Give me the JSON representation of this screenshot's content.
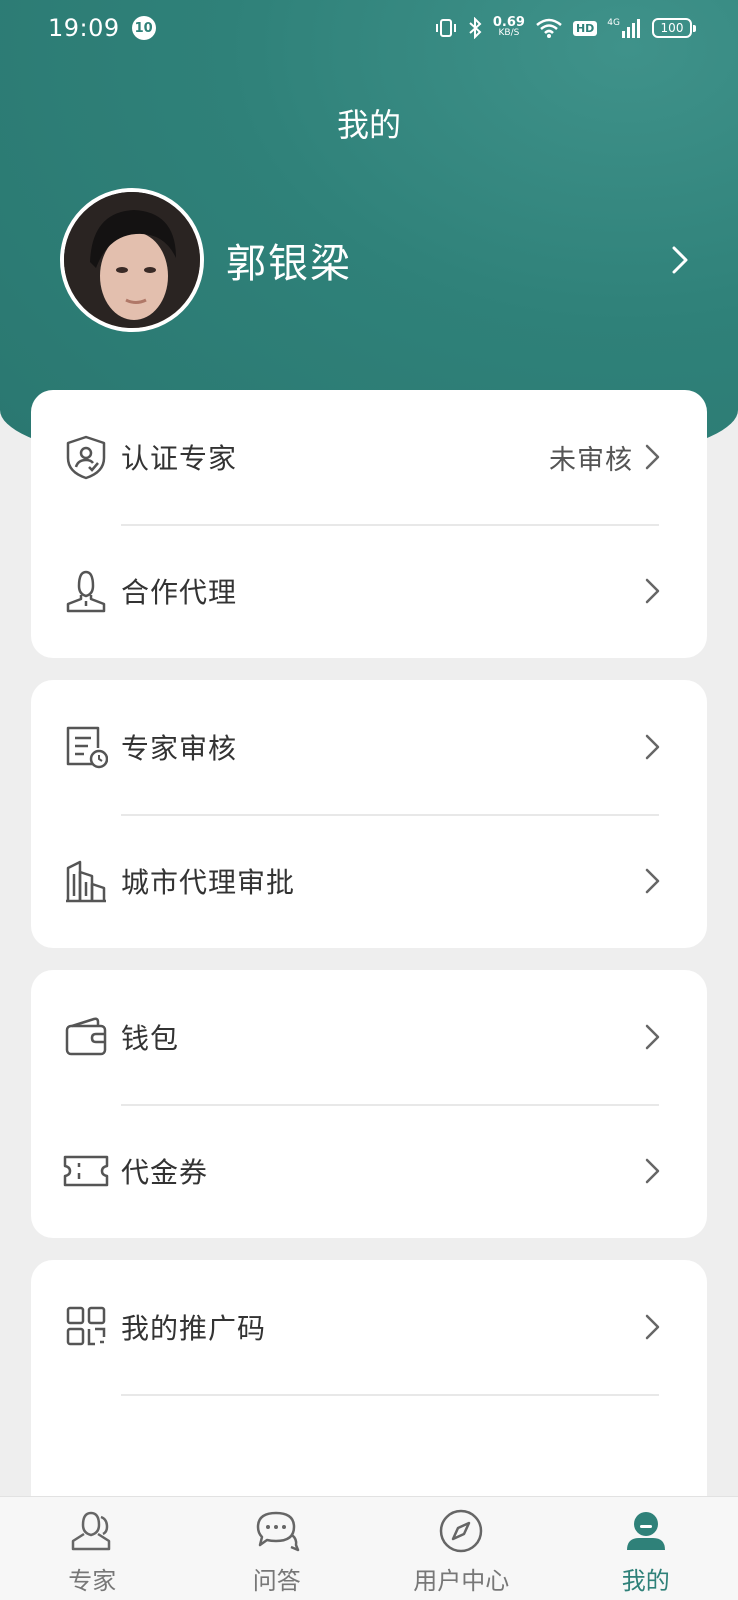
{
  "status_bar": {
    "time": "19:09",
    "notification_count": "10",
    "net_speed": "0.69",
    "net_unit": "KB/S",
    "hd": "HD",
    "network": "4G",
    "battery": "100"
  },
  "header": {
    "title": "我的"
  },
  "profile": {
    "name": "郭银梁"
  },
  "menu": {
    "cert_expert": {
      "label": "认证专家",
      "value": "未审核",
      "icon": "shield-user-icon"
    },
    "partner_agent": {
      "label": "合作代理",
      "icon": "person-icon"
    },
    "expert_review": {
      "label": "专家审核",
      "icon": "document-clock-icon"
    },
    "city_agent_approval": {
      "label": "城市代理审批",
      "icon": "buildings-icon"
    },
    "wallet": {
      "label": "钱包",
      "icon": "wallet-icon"
    },
    "voucher": {
      "label": "代金券",
      "icon": "ticket-icon"
    },
    "promo_code": {
      "label": "我的推广码",
      "icon": "qr-code-icon"
    }
  },
  "tabbar": {
    "experts": "专家",
    "qa": "问答",
    "user_center": "用户中心",
    "mine": "我的"
  },
  "colors": {
    "accent": "#2f8179",
    "background": "#eeeeee",
    "card": "#ffffff",
    "text": "#333333"
  }
}
